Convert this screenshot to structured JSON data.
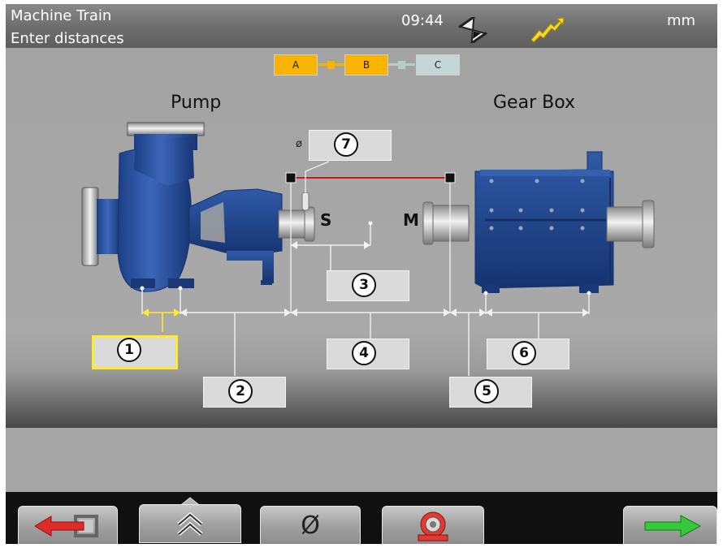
{
  "header": {
    "title": "Machine Train",
    "subtitle": "Enter distances",
    "time": "09:44",
    "unit": "mm",
    "icons": {
      "status": "hourglass-icon",
      "battery": "battery-charging-icon"
    }
  },
  "machine_path": {
    "items": [
      {
        "label": "A",
        "state": "active"
      },
      {
        "label": "B",
        "state": "active"
      },
      {
        "label": "C",
        "state": "inactive"
      }
    ],
    "colors": {
      "active": "#f9b400",
      "inactive": "#c5d6d6"
    }
  },
  "machines": {
    "left": "Pump",
    "right": "Gear Box"
  },
  "sensors": {
    "s": "S",
    "m": "M"
  },
  "diameter_symbol": "ø",
  "fields": [
    {
      "number": "1",
      "value": "",
      "selected": true
    },
    {
      "number": "2",
      "value": ""
    },
    {
      "number": "3",
      "value": ""
    },
    {
      "number": "4",
      "value": ""
    },
    {
      "number": "5",
      "value": ""
    },
    {
      "number": "6",
      "value": ""
    },
    {
      "number": "7",
      "value": ""
    }
  ],
  "toolbar": {
    "back": "arrow-left-icon",
    "up": "double-chevron-up-icon",
    "diameter": "Ø",
    "machine": "machine-icon",
    "next": "arrow-right-icon"
  },
  "colors": {
    "selection": "#ffea2b",
    "laser_line": "#c81818",
    "back_arrow": "#e02a2a",
    "next_arrow": "#35c838"
  }
}
